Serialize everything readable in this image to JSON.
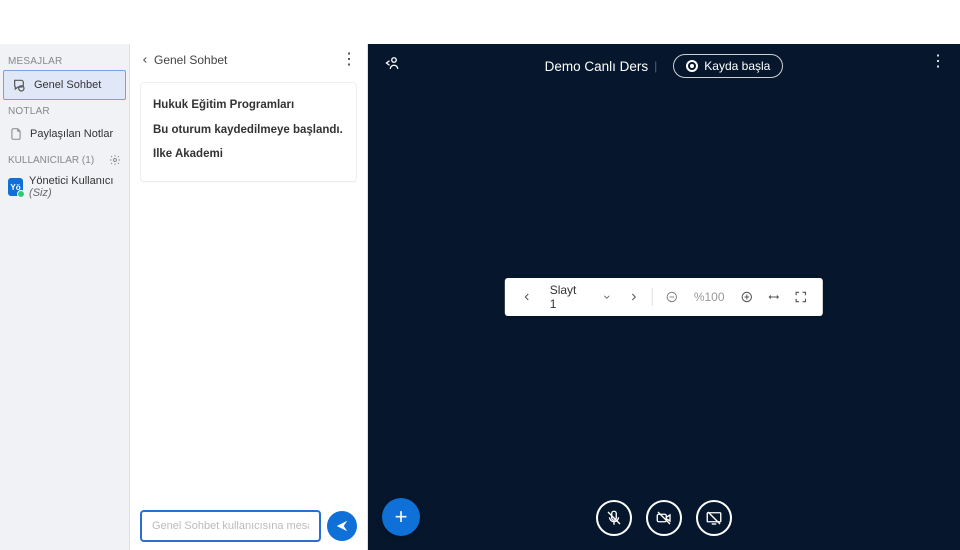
{
  "sidebar": {
    "section_messages": "MESAJLAR",
    "item_general_chat": "Genel Sohbet",
    "section_notes": "NOTLAR",
    "item_shared_notes": "Paylaşılan Notlar",
    "section_users_label": "KULLANICILAR",
    "users_count": "(1)",
    "user_avatar_initials": "Yö",
    "user_name": "Yönetici Kullanıcı",
    "user_you": "(Siz)"
  },
  "chat": {
    "back_label": "Genel Sohbet",
    "msg_line1": "Hukuk Eğitim Programları",
    "msg_line2": "Bu oturum kaydedilmeye başlandı.",
    "msg_line3": "Ilke Akademi",
    "input_placeholder": "Genel Sohbet kullanıcısına mesaj gönder"
  },
  "presentation": {
    "title": "Demo Canlı Ders",
    "record_label": "Kayda başla",
    "slide_label": "Slayt 1",
    "zoom_label": "%100"
  }
}
